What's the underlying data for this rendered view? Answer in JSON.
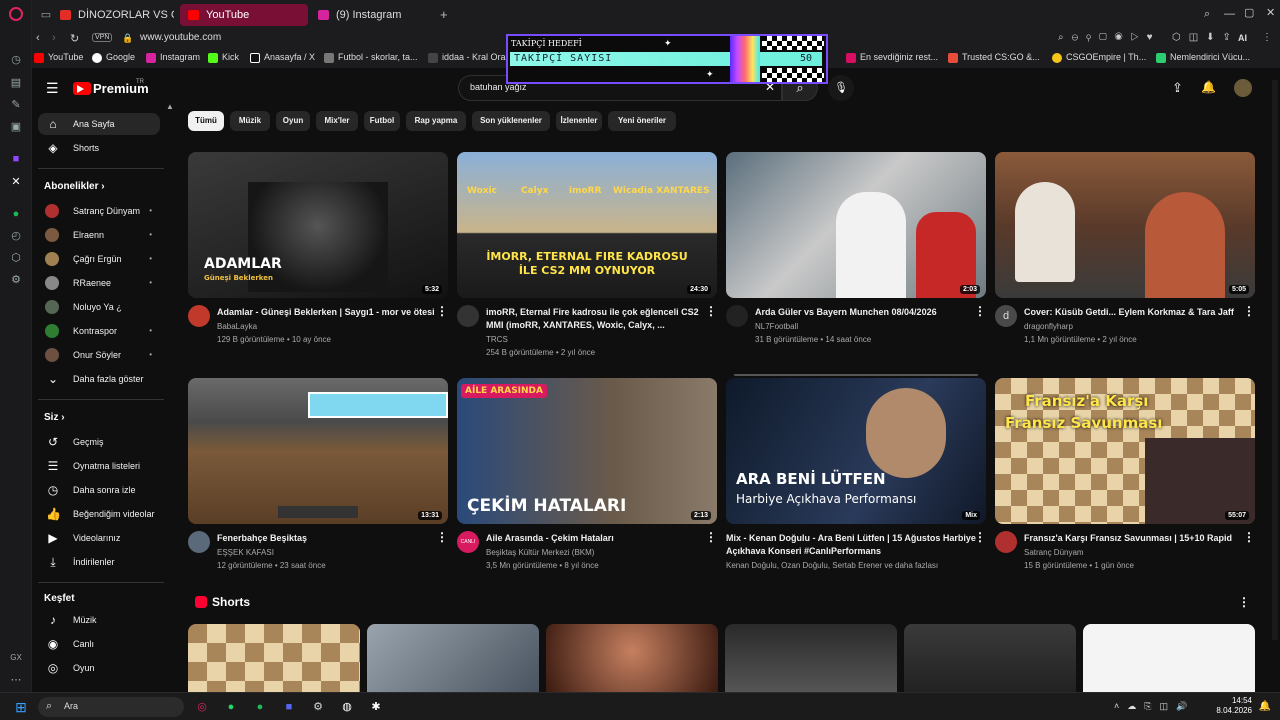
{
  "browser": {
    "tabs": [
      {
        "label": "DİNOZORLAR VS GENÇLE",
        "color": "#e52d27"
      },
      {
        "label": "YouTube",
        "color": "#ff0000"
      },
      {
        "label": "(9) Instagram",
        "color": "#d6249f"
      }
    ],
    "new_tab": "+",
    "vpn": "VPN",
    "url": "www.youtube.com",
    "ai_label": "AI",
    "bookmarks": [
      {
        "label": "YouTube",
        "color": "#ff0000"
      },
      {
        "label": "Google",
        "color": "#ffffff"
      },
      {
        "label": "Instagram",
        "color": "#d6249f"
      },
      {
        "label": "Kick",
        "color": "#53fc18"
      },
      {
        "label": "Anasayfa / X",
        "color": "#ffffff"
      },
      {
        "label": "Futbol - skorlar, ta...",
        "color": "#777777"
      },
      {
        "label": "iddaa - Kral Oran",
        "color": "#444444"
      },
      {
        "label": "En sevdiğiniz rest...",
        "color": "#d70f64"
      },
      {
        "label": "Trusted CS:GO &...",
        "color": "#e74c3c"
      },
      {
        "label": "CSGOEmpire | Th...",
        "color": "#f5c518"
      },
      {
        "label": "Nemlendirici Vücu...",
        "color": "#2ecc71"
      }
    ],
    "rail_labels": [
      "GX"
    ]
  },
  "overlay": {
    "label": "TAKİPÇİ HEDEFİ",
    "bar_text": "TAKİPÇİ SAYISI",
    "value": "50"
  },
  "youtube": {
    "logo": "Premium",
    "logo_sup": "TR",
    "search_value": "batuhan yağız",
    "chips": [
      "Tümü",
      "Müzik",
      "Oyun",
      "Mix'ler",
      "Futbol",
      "Rap yapma",
      "Son yüklenenler",
      "İzlenenler",
      "Yeni öneriler"
    ],
    "sidebar": {
      "home": "Ana Sayfa",
      "shorts": "Shorts",
      "subs_head": "Abonelikler",
      "subs": [
        {
          "name": "Satranç Dünyam",
          "color": "#b03030"
        },
        {
          "name": "Elraenn",
          "color": "#7a5a40"
        },
        {
          "name": "Çağrı Ergün",
          "color": "#a08050"
        },
        {
          "name": "RRaenee",
          "color": "#888888"
        },
        {
          "name": "Noluyo Ya ¿",
          "color": "#556655"
        },
        {
          "name": "Kontraspor",
          "color": "#2e7d32"
        },
        {
          "name": "Onur Söyler",
          "color": "#6d5040"
        }
      ],
      "more": "Daha fazla göster",
      "you_head": "Siz",
      "you": [
        "Geçmiş",
        "Oynatma listeleri",
        "Daha sonra izle",
        "Beğendiğim videolar",
        "Videolarınız",
        "İndirilenler"
      ],
      "explore_head": "Keşfet",
      "explore": [
        "Müzik",
        "Canlı",
        "Oyun"
      ]
    },
    "videos": [
      {
        "title": "Adamlar - Güneşi Beklerken | Saygı1 - mor ve ötesi",
        "channel": "BabaLayka",
        "meta": "129 B görüntüleme • 10 ay önce",
        "duration": "5:32",
        "thumb_text": "ADAMLAR",
        "thumb_sub": "Güneşi Beklerken",
        "avatar": "#c0392b"
      },
      {
        "title": "imoRR, Eternal Fire kadrosu ile çok eğlenceli CS2 MMI (imoRR, XANTARES, Woxic, Calyx, ...",
        "channel": "TRCS",
        "meta": "254 B görüntüleme • 2 yıl önce",
        "duration": "24:30",
        "thumb_text": "İMORR, ETERNAL FIRE KADROSU İLE CS2 MM OYNUYOR",
        "names": [
          "Woxic",
          "Calyx",
          "imoRR",
          "Wicadia XANTARES"
        ],
        "avatar": "#333333"
      },
      {
        "title": "Arda Güler vs Bayern Munchen 08/04/2026",
        "channel": "NL7Football",
        "meta": "31 B görüntüleme • 14 saat önce",
        "duration": "2:03",
        "avatar": "#222222"
      },
      {
        "title": "Cover: Küsüb Getdi... Eylem Korkmaz & Tara Jaff",
        "channel": "dragonflyharp",
        "meta": "1,1 Mn görüntüleme • 2 yıl önce",
        "duration": "5:05",
        "avatar": "#4a4a4a",
        "avatar_letter": "d"
      },
      {
        "title": "Fenerbahçe Beşiktaş",
        "channel": "EŞŞEK KAFASI",
        "meta": "12 görüntüleme • 23 saat önce",
        "duration": "13:31",
        "avatar": "#5a6a7a"
      },
      {
        "title": "Aile Arasında - Çekim Hataları",
        "channel": "Beşiktaş Kültür Merkezi (BKM)",
        "meta": "3,5 Mn görüntüleme • 8 yıl önce",
        "duration": "2:13",
        "thumb_text": "ÇEKİM HATALARI",
        "badge": "AİLE ARASINDA",
        "avatar": "#d81b60",
        "avatar_text": "CANLI"
      },
      {
        "title": "Mix - Kenan Doğulu - Ara Beni Lütfen | 15 Ağustos Harbiye Açıkhava Konseri #CanlıPerformans",
        "channel": "Kenan Doğulu, Ozan Doğulu, Sertab Erener ve daha fazlası",
        "meta": "",
        "duration": "Mix",
        "thumb_text": "ARA BENİ LÜTFEN",
        "thumb_sub": "Harbiye Açıkhava Performansı"
      },
      {
        "title": "Fransız'a Karşı Fransız Savunması | 15+10 Rapid",
        "channel": "Satranç Dünyam",
        "meta": "15 B görüntüleme • 1 gün önce",
        "duration": "55:07",
        "thumb_text": "Fransız'a Karşı",
        "thumb_sub": "Fransız Savunması",
        "avatar": "#b03030"
      }
    ],
    "shorts_title": "Shorts"
  },
  "taskbar": {
    "search": "Ara",
    "time": "14:54",
    "date": "8.04.2026"
  }
}
